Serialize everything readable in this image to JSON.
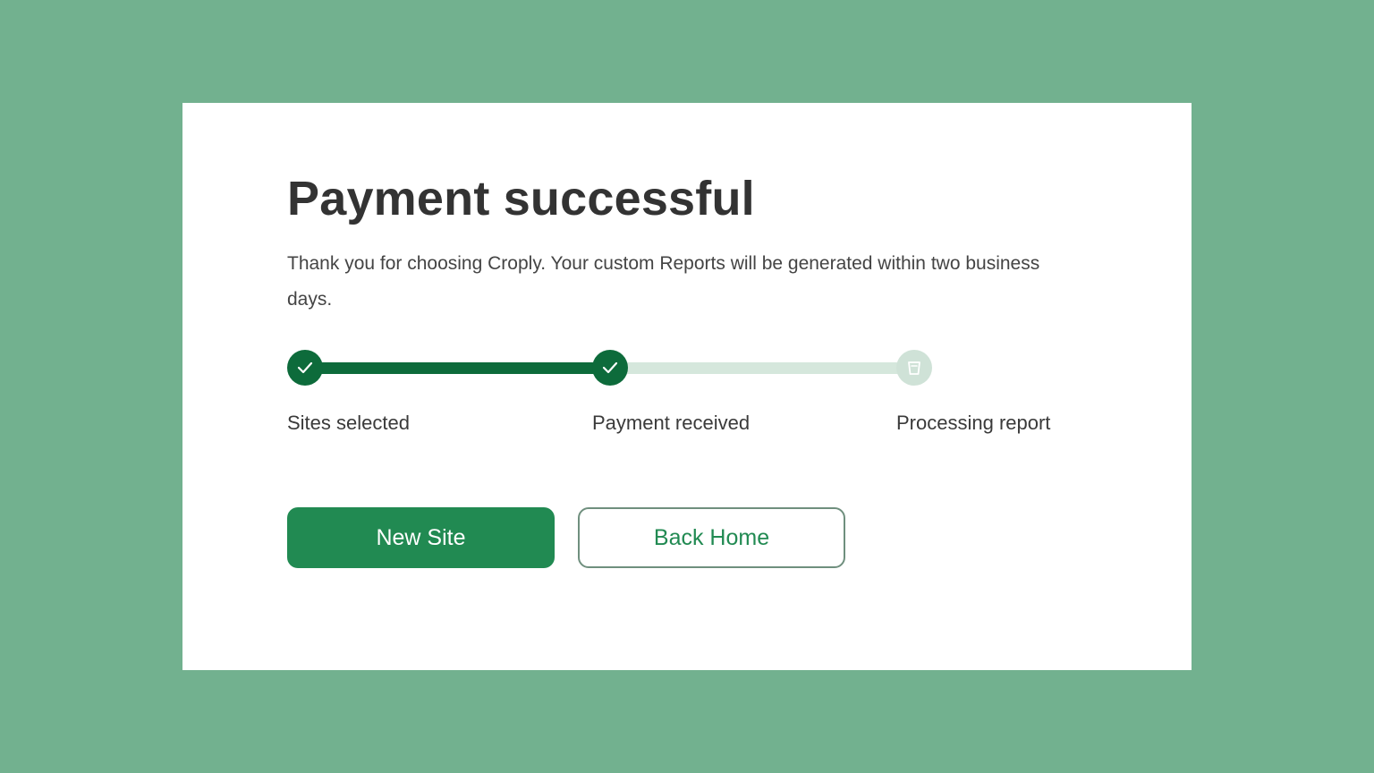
{
  "page": {
    "title": "Payment successful",
    "description": "Thank you for choosing Croply. Your custom Reports will be generated within two business days."
  },
  "progress": {
    "completed_steps": 2,
    "total_steps": 3,
    "steps": [
      {
        "label": "Sites selected",
        "status": "complete",
        "icon": "check-icon"
      },
      {
        "label": "Payment received",
        "status": "complete",
        "icon": "check-icon"
      },
      {
        "label": "Processing report",
        "status": "pending",
        "icon": "cup-icon"
      }
    ]
  },
  "actions": {
    "primary_label": "New Site",
    "secondary_label": "Back Home"
  },
  "colors": {
    "background": "#72b18f",
    "primary": "#218a52",
    "progress_fill": "#0d6b3b",
    "progress_track": "#d5e7dc",
    "text": "#333333"
  }
}
